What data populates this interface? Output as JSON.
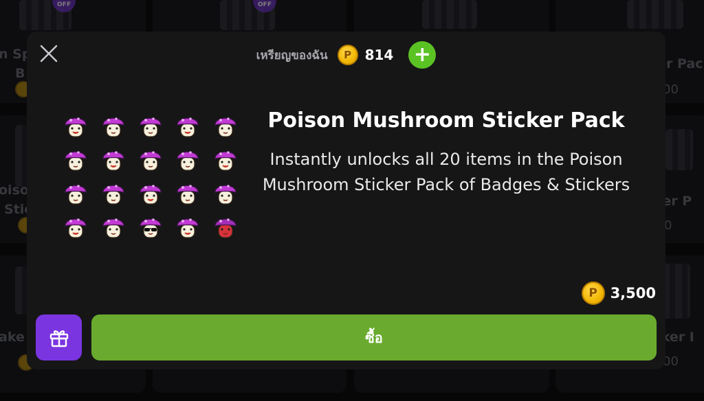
{
  "background": {
    "titles": [
      "n Sp",
      "B",
      "oisor",
      "Stick",
      "ake",
      "ker Pac",
      "cker P",
      "icker I"
    ],
    "prices": [
      "00",
      "0",
      "00"
    ],
    "badge_label": "OFF"
  },
  "modal": {
    "balance": {
      "label": "เหรียญของฉัน",
      "coin_icon": "P",
      "amount": "814",
      "add_label": "+"
    },
    "product": {
      "title": "Poison Mushroom Sticker Pack",
      "description": "Instantly unlocks all 20 items in the Poison Mushroom Sticker Pack of Badges & Stickers",
      "sticker_count": 20
    },
    "price": {
      "coin_icon": "P",
      "amount": "3,500"
    },
    "buy_label": "ซื้อ"
  },
  "colors": {
    "accent_green": "#6aab2f",
    "add_green": "#5bc224",
    "gift_purple": "#7b35e0",
    "coin_gold": "#f2b705",
    "mushroom_cap": "#c13ad4"
  }
}
